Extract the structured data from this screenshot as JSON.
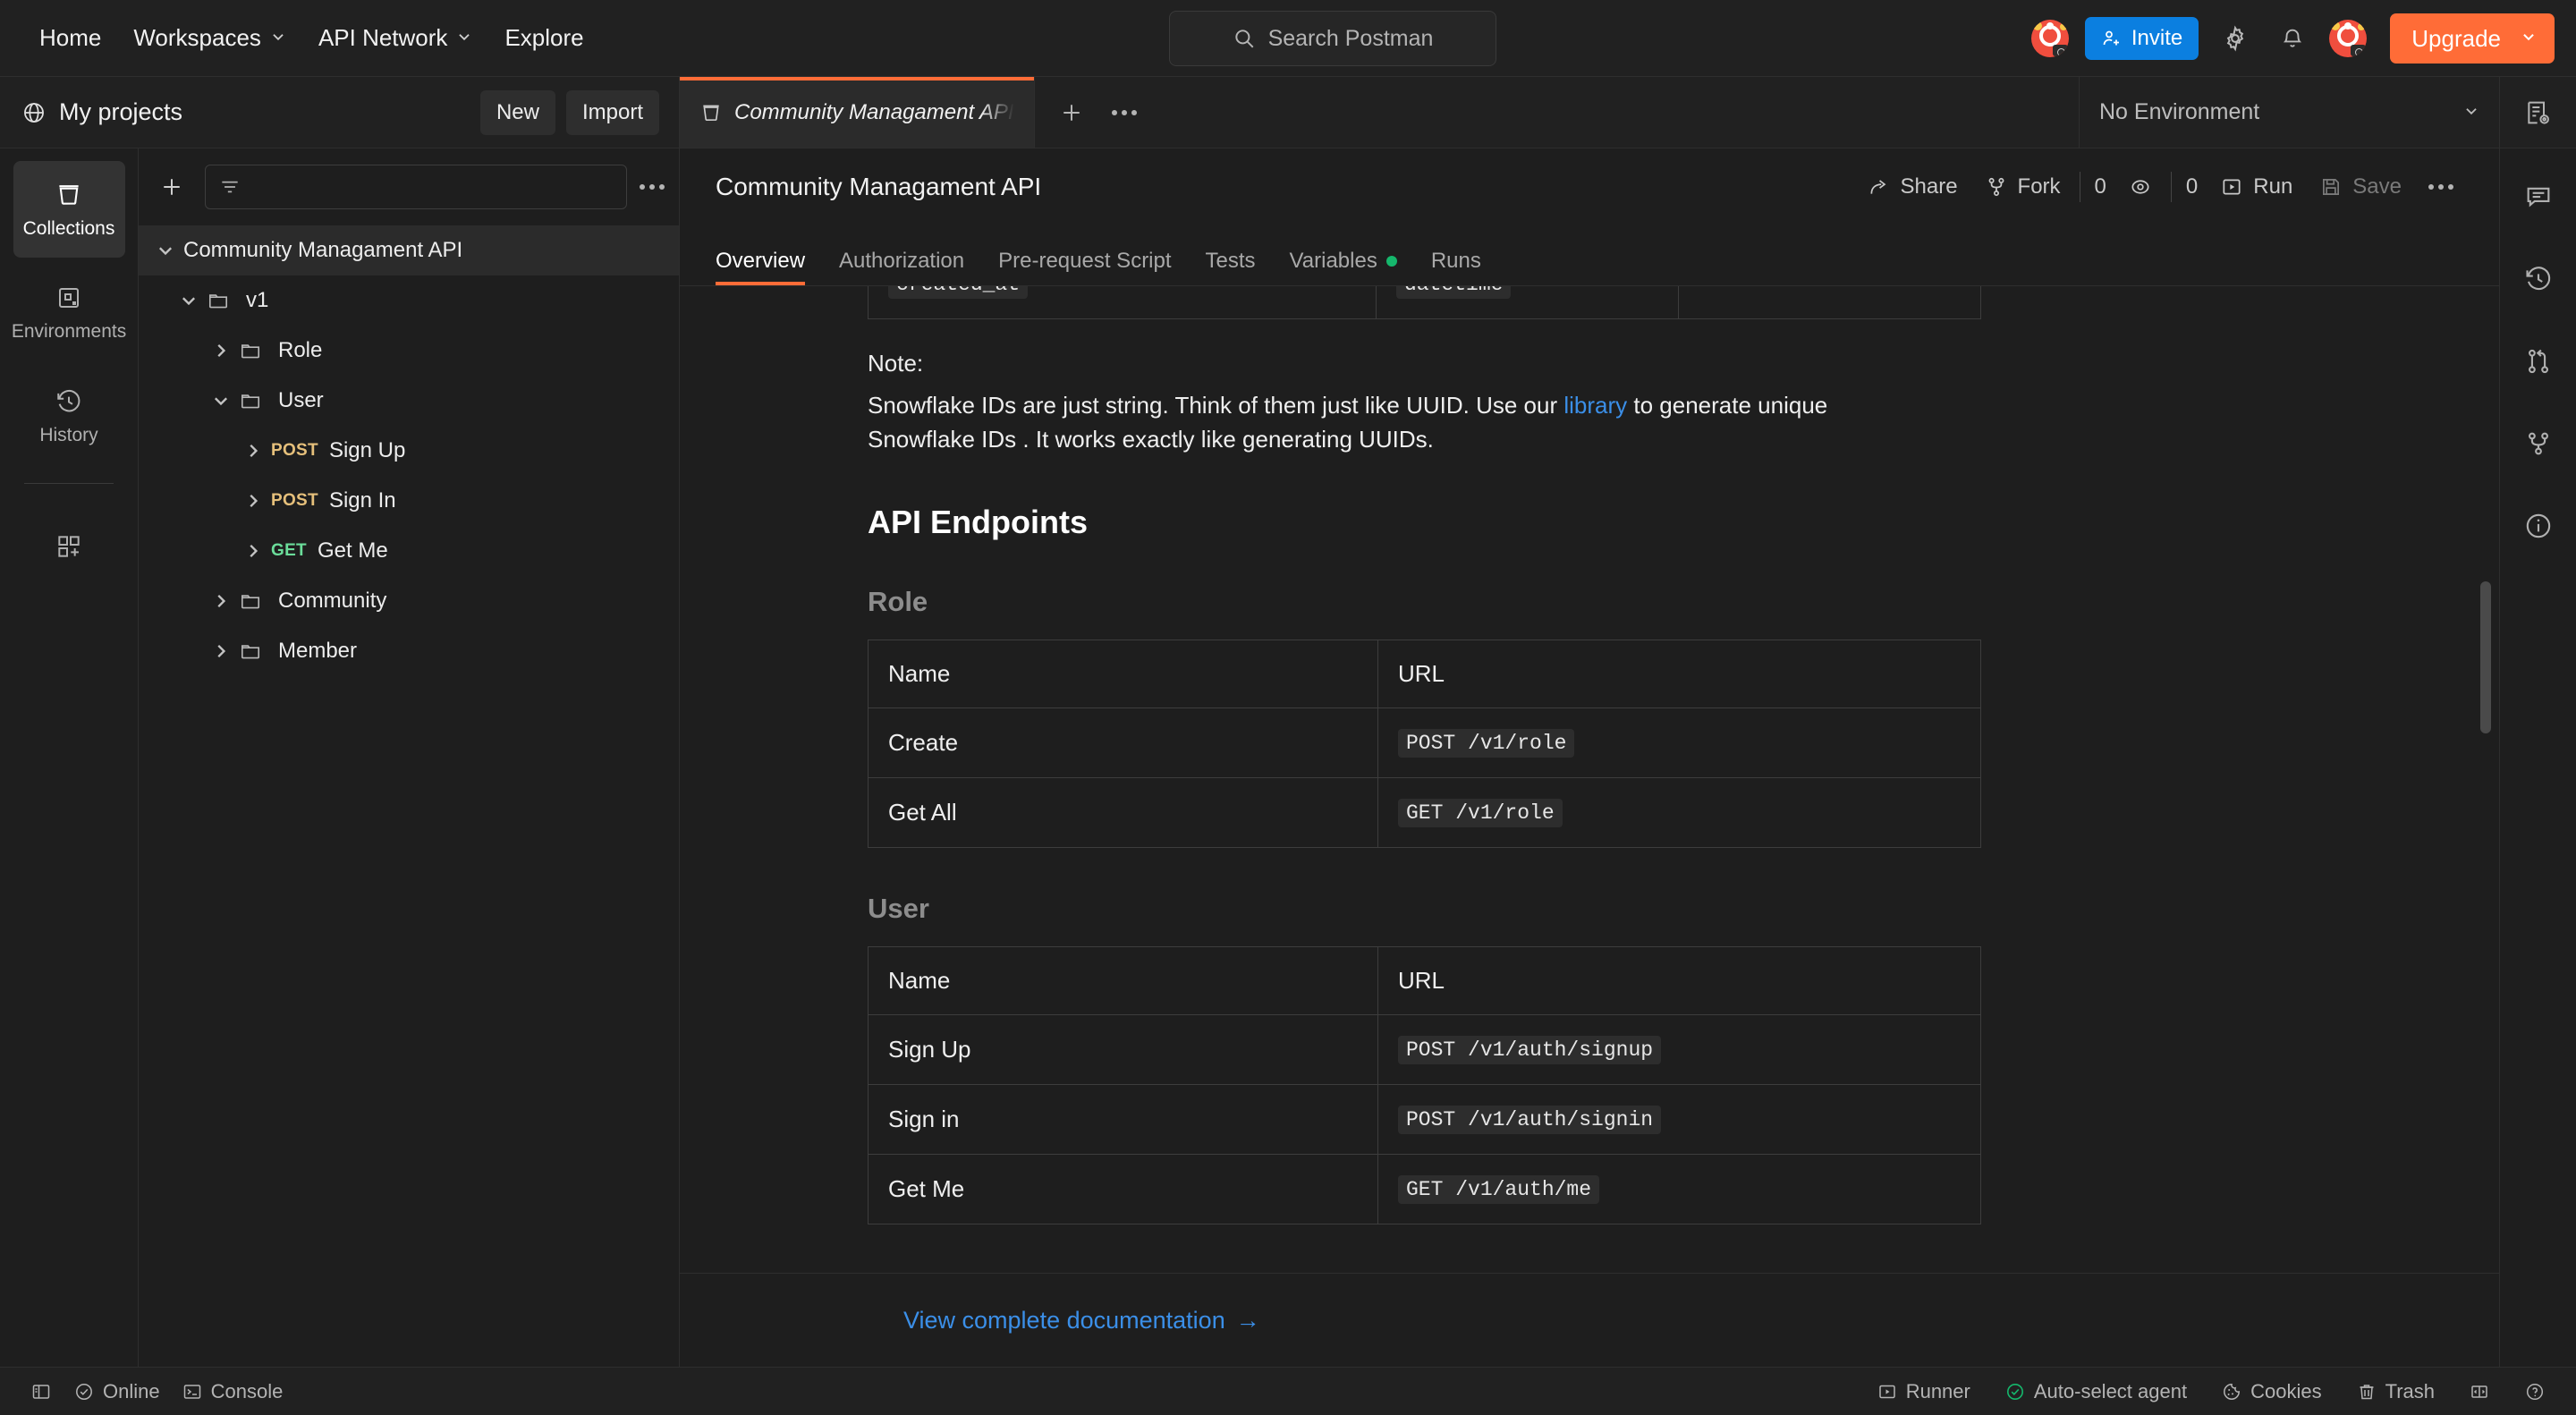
{
  "topbar": {
    "nav": [
      {
        "label": "Home",
        "has_chevron": false
      },
      {
        "label": "Workspaces",
        "has_chevron": true
      },
      {
        "label": "API Network",
        "has_chevron": true
      },
      {
        "label": "Explore",
        "has_chevron": false
      }
    ],
    "search": {
      "placeholder": "Search Postman",
      "icon": "search-icon"
    },
    "invite_label": "Invite",
    "upgrade_label": "Upgrade",
    "icons": [
      "settings-gear-icon",
      "notification-bell-icon"
    ]
  },
  "workspace": {
    "title": "My projects",
    "new_label": "New",
    "import_label": "Import"
  },
  "tabs": {
    "items": [
      {
        "label": "Community Managament API",
        "active": true,
        "unsaved": true
      }
    ],
    "add_label": "+",
    "more_label": "•••"
  },
  "environment": {
    "selected": "No Environment"
  },
  "rail": {
    "items": [
      {
        "label": "Collections",
        "icon": "collections-icon",
        "active": true
      },
      {
        "label": "Environments",
        "icon": "environments-icon",
        "active": false
      },
      {
        "label": "History",
        "icon": "history-icon",
        "active": false
      }
    ],
    "add_label": "new-element-icon"
  },
  "collection_panel": {
    "filter_placeholder": "",
    "tree": [
      {
        "label": "Community Managament API",
        "type": "collection",
        "depth": 0,
        "expanded": true,
        "selected": true
      },
      {
        "label": "v1",
        "type": "folder",
        "depth": 1,
        "expanded": true
      },
      {
        "label": "Role",
        "type": "folder",
        "depth": 2,
        "expanded": false
      },
      {
        "label": "User",
        "type": "folder",
        "depth": 2,
        "expanded": true
      },
      {
        "label": "Sign Up",
        "type": "request",
        "method": "POST",
        "depth": 3
      },
      {
        "label": "Sign In",
        "type": "request",
        "method": "POST",
        "depth": 3
      },
      {
        "label": "Get Me",
        "type": "request",
        "method": "GET",
        "depth": 3
      },
      {
        "label": "Community",
        "type": "folder",
        "depth": 2,
        "expanded": false
      },
      {
        "label": "Member",
        "type": "folder",
        "depth": 2,
        "expanded": false
      }
    ]
  },
  "doc_header": {
    "title": "Community Managament API",
    "share_label": "Share",
    "fork_label": "Fork",
    "fork_count": "0",
    "watch_count": "0",
    "run_label": "Run",
    "save_label": "Save"
  },
  "doc_tabs": [
    {
      "label": "Overview",
      "active": true
    },
    {
      "label": "Authorization",
      "active": false
    },
    {
      "label": "Pre-request Script",
      "active": false
    },
    {
      "label": "Tests",
      "active": false
    },
    {
      "label": "Variables",
      "active": false,
      "dot": true
    },
    {
      "label": "Runs",
      "active": false
    }
  ],
  "doc": {
    "cut_table": {
      "col1": "created_at",
      "col2": "datetime"
    },
    "note_heading": "Note:",
    "note_part1": "Snowflake IDs are just string. Think of them just like UUID. Use our ",
    "note_link": "library",
    "note_part2": " to generate unique Snowflake IDs . It works exactly like generating UUIDs.",
    "endpoints_heading": "API Endpoints",
    "groups": [
      {
        "name": "Role",
        "headers": [
          "Name",
          "URL"
        ],
        "rows": [
          {
            "name": "Create",
            "url": "POST /v1/role"
          },
          {
            "name": "Get All",
            "url": "GET /v1/role"
          }
        ]
      },
      {
        "name": "User",
        "headers": [
          "Name",
          "URL"
        ],
        "rows": [
          {
            "name": "Sign Up",
            "url": "POST /v1/auth/signup"
          },
          {
            "name": "Sign in",
            "url": "POST /v1/auth/signin"
          },
          {
            "name": "Get Me",
            "url": "GET /v1/auth/me"
          }
        ]
      }
    ],
    "view_docs_label": "View complete documentation",
    "view_docs_arrow": "→"
  },
  "right_rail": {
    "items": [
      {
        "icon": "comment-icon"
      },
      {
        "icon": "history-clock-icon"
      },
      {
        "icon": "pull-request-icon"
      },
      {
        "icon": "fork-branch-icon"
      },
      {
        "icon": "info-circle-icon"
      }
    ]
  },
  "footer": {
    "left": [
      {
        "label": "",
        "icon": "sidebar-toggle-icon"
      },
      {
        "label": "Online",
        "icon": "status-check-icon"
      },
      {
        "label": "Console",
        "icon": "console-icon"
      }
    ],
    "right": [
      {
        "label": "Runner",
        "icon": "runner-icon"
      },
      {
        "label": "Auto-select agent",
        "icon": "agent-check-icon"
      },
      {
        "label": "Cookies",
        "icon": "cookie-icon"
      },
      {
        "label": "Trash",
        "icon": "trash-icon"
      },
      {
        "label": "",
        "icon": "layout-panel-icon"
      },
      {
        "label": "",
        "icon": "help-circle-icon"
      }
    ]
  },
  "colors": {
    "accent_orange": "#ff6c37",
    "link_blue": "#3b8fe8",
    "invite_blue": "#0b7fe8",
    "post_yellow": "#e6c07b",
    "get_green": "#6bdd9a",
    "status_green": "#15b76c"
  }
}
